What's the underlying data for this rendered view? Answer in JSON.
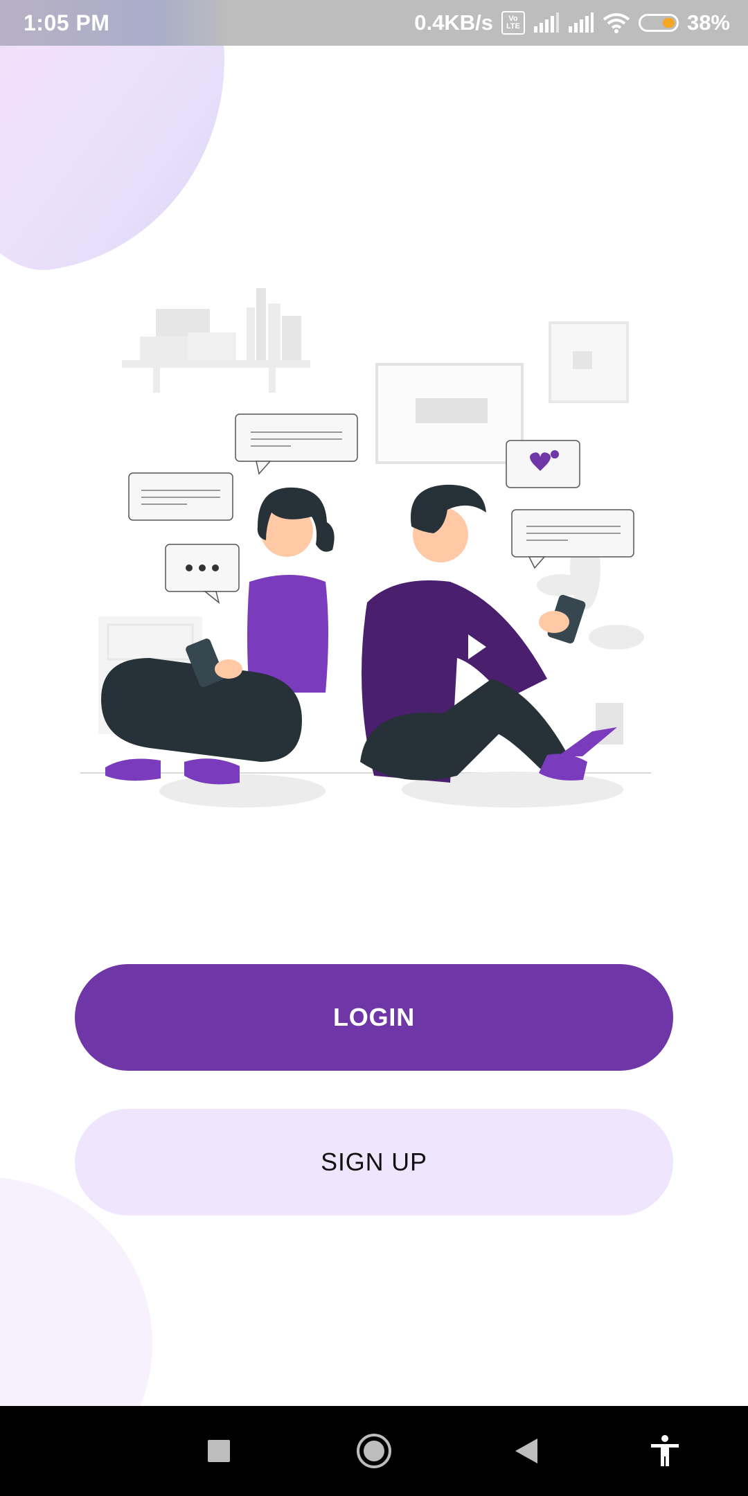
{
  "status_bar": {
    "time": "1:05 PM",
    "network_speed": "0.4KB/s",
    "volte_top": "Vo",
    "volte_bottom": "LTE",
    "battery_percent": "38%",
    "battery_level": 0.38,
    "icons": [
      "volte-icon",
      "signal-icon",
      "signal-icon",
      "wifi-icon",
      "battery-icon"
    ]
  },
  "actions": {
    "login_label": "LOGIN",
    "signup_label": "SIGN UP"
  },
  "nav_bar": {
    "icons": [
      "recents-square-icon",
      "home-circle-icon",
      "back-triangle-icon",
      "accessibility-icon"
    ]
  },
  "colors": {
    "primary": "#6f36a8",
    "secondary_bg": "#efe6fd",
    "status_bar": "#bdbdbd",
    "nav_bar": "#000000"
  }
}
